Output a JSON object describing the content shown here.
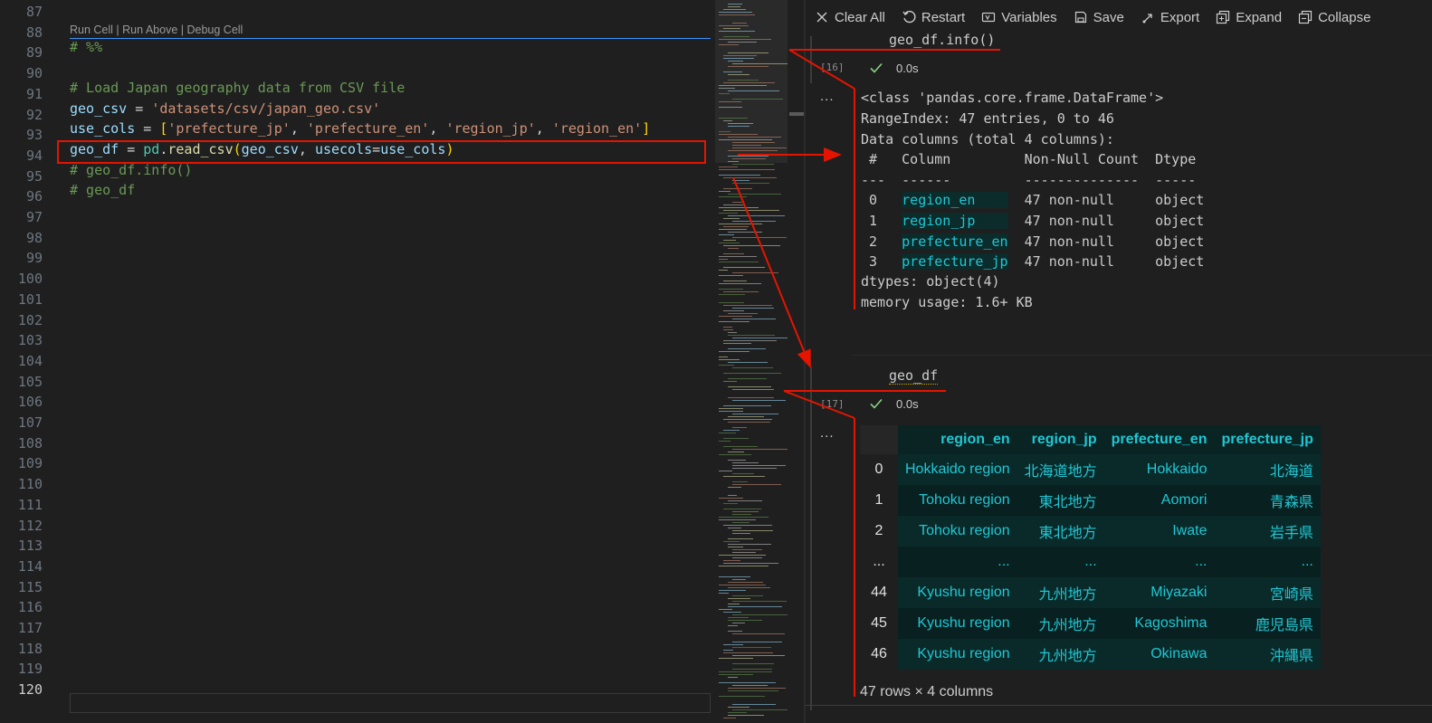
{
  "editor": {
    "codelens": "Run Cell | Run Above | Debug Cell",
    "line_numbers": [
      "87",
      "88",
      "89",
      "90",
      "91",
      "92",
      "93",
      "94",
      "95",
      "96",
      "97",
      "98",
      "99",
      "100",
      "101",
      "102",
      "103",
      "104",
      "105",
      "106",
      "107",
      "108",
      "109",
      "110",
      "111",
      "112",
      "113",
      "114",
      "115",
      "116",
      "117",
      "118",
      "119",
      "120"
    ],
    "lines": {
      "l88": "# %%",
      "l90": "# Load Japan geography data from CSV file",
      "l91_var": "geo_csv",
      "l91_op": " = ",
      "l91_str": "'datasets/csv/japan_geo.csv'",
      "l92_var": "use_cols",
      "l92_op": " = ",
      "l92_open": "[",
      "l92_s1": "'prefecture_jp'",
      "l92_s2": "'prefecture_en'",
      "l92_s3": "'region_jp'",
      "l92_s4": "'region_en'",
      "l92_close": "]",
      "l92_comma": ", ",
      "l93_var": "geo_df",
      "l93_op": " = ",
      "l93_mod": "pd",
      "l93_dot": ".",
      "l93_fn": "read_csv",
      "l93_open": "(",
      "l93_arg1": "geo_csv",
      "l93_comma": ", ",
      "l93_kw": "usecols",
      "l93_eq": "=",
      "l93_arg2": "use_cols",
      "l93_close": ")",
      "l94": "# geo_df.info()",
      "l95": "# geo_df"
    }
  },
  "toolbar": {
    "clear_all": "Clear All",
    "restart": "Restart",
    "variables": "Variables",
    "save": "Save",
    "export": "Export",
    "expand": "Expand",
    "collapse": "Collapse"
  },
  "cell16": {
    "code": "geo_df.info()",
    "exec_count": "[16]",
    "exec_time": "0.0s",
    "more": "...",
    "output": {
      "line1": "<class 'pandas.core.frame.DataFrame'>",
      "line2": "RangeIndex: 47 entries, 0 to 46",
      "line3": "Data columns (total 4 columns):",
      "header": " #   Column         Non-Null Count  Dtype ",
      "divider": "---  ------         --------------  ----- ",
      "rows": [
        {
          "idx": " 0   ",
          "col": "region_en    ",
          "rest": "  47 non-null     object"
        },
        {
          "idx": " 1   ",
          "col": "region_jp    ",
          "rest": "  47 non-null     object"
        },
        {
          "idx": " 2   ",
          "col": "prefecture_en",
          "rest": "  47 non-null     object"
        },
        {
          "idx": " 3   ",
          "col": "prefecture_jp",
          "rest": "  47 non-null     object"
        }
      ],
      "dtypes": "dtypes: object(4)",
      "memory": "memory usage: 1.6+ KB"
    }
  },
  "cell17": {
    "code": "geo_df",
    "exec_count": "[17]",
    "exec_time": "0.0s",
    "more": "...",
    "table": {
      "columns": [
        "region_en",
        "region_jp",
        "prefecture_en",
        "prefecture_jp"
      ],
      "rows": [
        {
          "index": "0",
          "cells": [
            "Hokkaido region",
            "北海道地方",
            "Hokkaido",
            "北海道"
          ]
        },
        {
          "index": "1",
          "cells": [
            "Tohoku region",
            "東北地方",
            "Aomori",
            "青森県"
          ]
        },
        {
          "index": "2",
          "cells": [
            "Tohoku region",
            "東北地方",
            "Iwate",
            "岩手県"
          ]
        },
        {
          "index": "...",
          "cells": [
            "...",
            "...",
            "...",
            "..."
          ]
        },
        {
          "index": "44",
          "cells": [
            "Kyushu region",
            "九州地方",
            "Miyazaki",
            "宮崎県"
          ]
        },
        {
          "index": "45",
          "cells": [
            "Kyushu region",
            "九州地方",
            "Kagoshima",
            "鹿児島県"
          ]
        },
        {
          "index": "46",
          "cells": [
            "Kyushu region",
            "九州地方",
            "Okinawa",
            "沖縄県"
          ]
        }
      ],
      "shape": "47 rows × 4 columns"
    }
  },
  "colors": {
    "annotation_red": "#e51400",
    "accent_blue": "#3794ff",
    "table_text": "#1fc7d4"
  }
}
